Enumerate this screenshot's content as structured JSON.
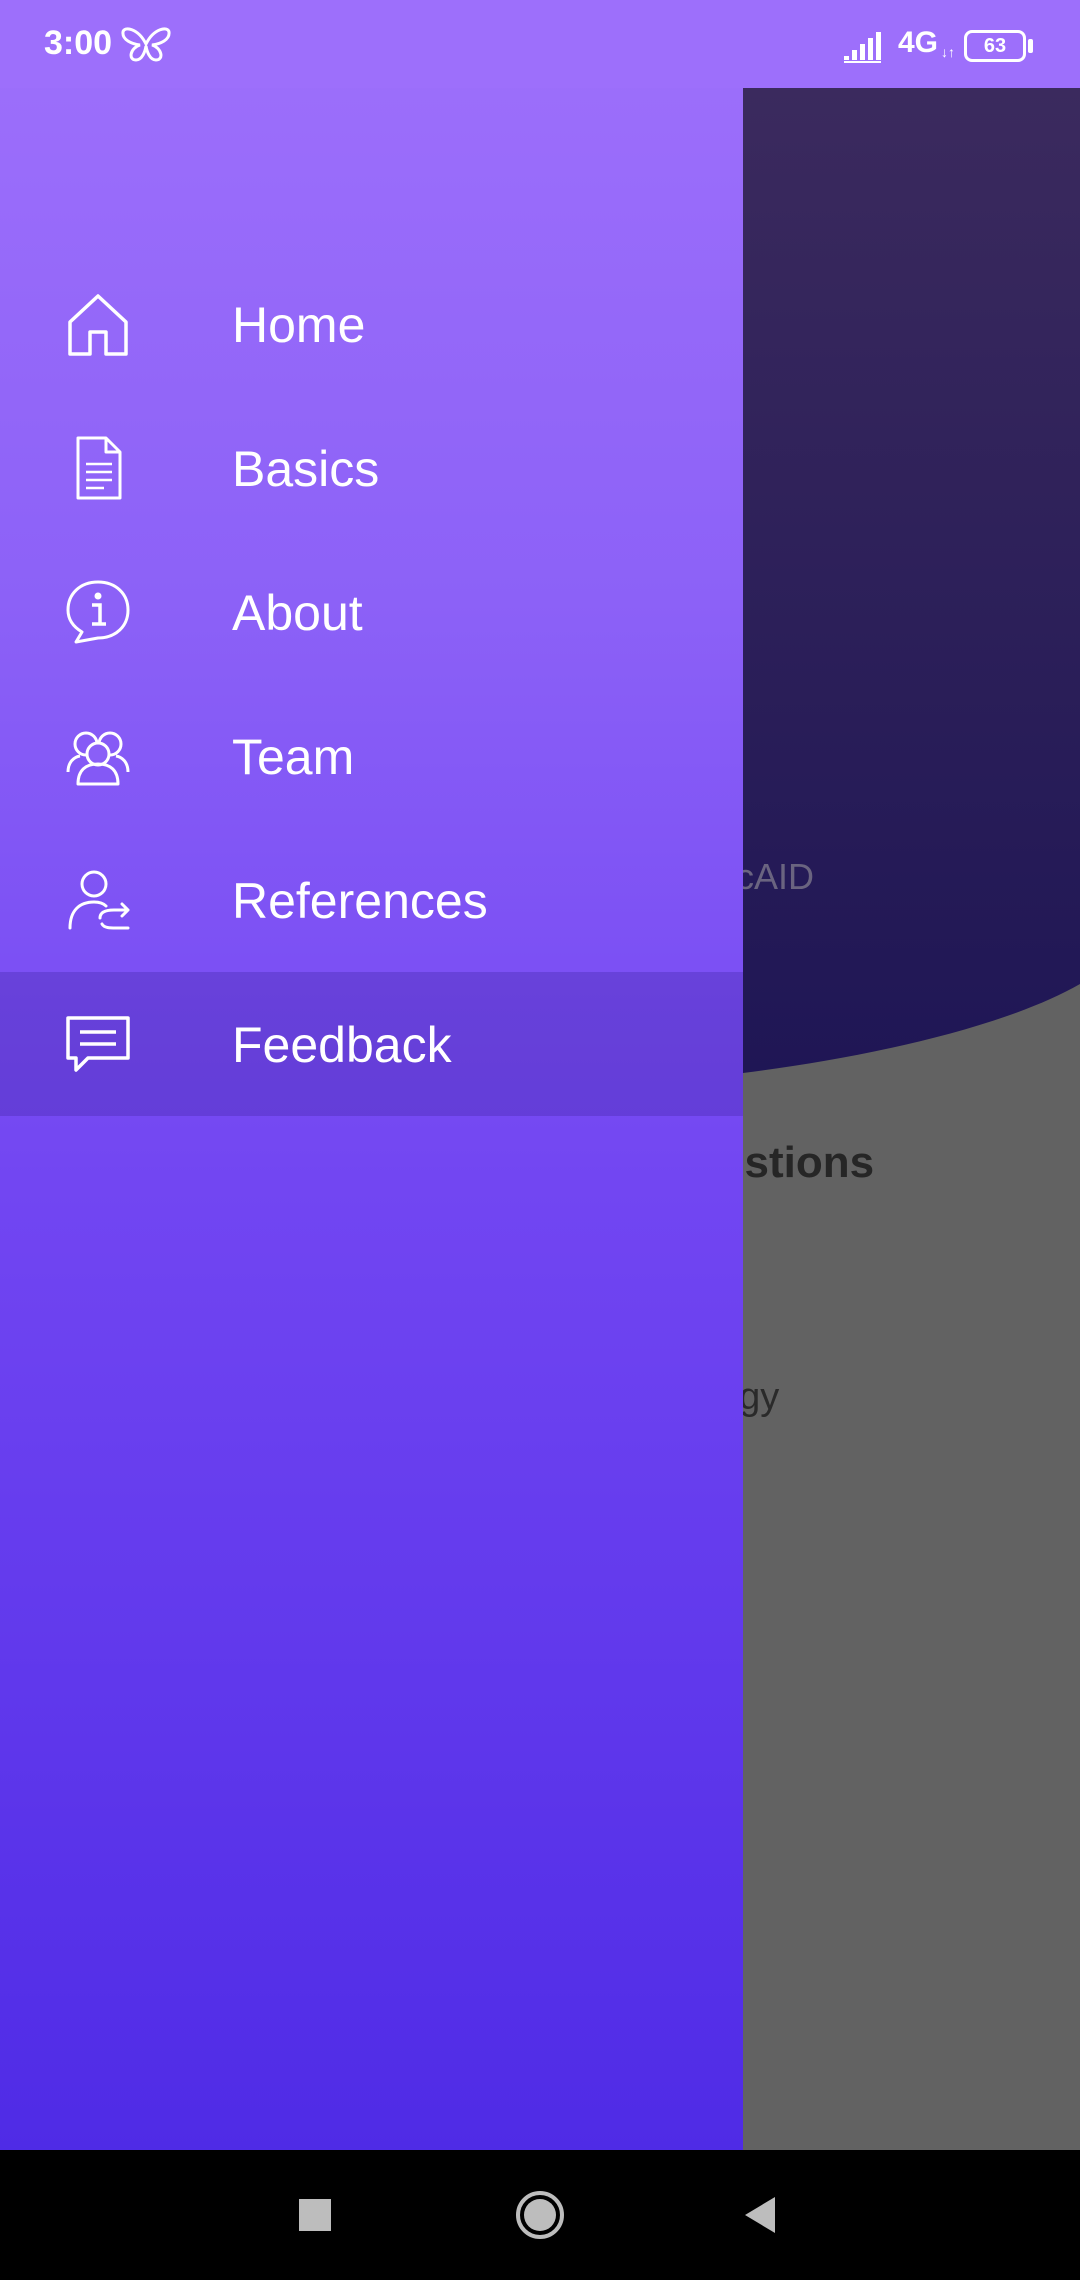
{
  "status_bar": {
    "time": "3:00",
    "network": "4G",
    "network_arrows": "↓↑",
    "battery": "63"
  },
  "drawer": {
    "items": [
      {
        "label": "Home",
        "icon": "home-icon",
        "selected": false
      },
      {
        "label": "Basics",
        "icon": "document-icon",
        "selected": false
      },
      {
        "label": "About",
        "icon": "info-icon",
        "selected": false
      },
      {
        "label": "Team",
        "icon": "team-icon",
        "selected": false
      },
      {
        "label": "References",
        "icon": "user-share-icon",
        "selected": false
      },
      {
        "label": "Feedback",
        "icon": "chat-icon",
        "selected": true
      }
    ]
  },
  "background_app": {
    "text_1": "ficAID",
    "text_2": "estions",
    "text_3": "ogy"
  },
  "colors": {
    "drawer_top": "#9e70fb",
    "drawer_bottom": "#4f2be6",
    "hero_dark": "#1f1655",
    "scrim": "#626262"
  },
  "nav_bar": {
    "recents": "square-icon",
    "home": "circle-icon",
    "back": "triangle-back-icon"
  }
}
